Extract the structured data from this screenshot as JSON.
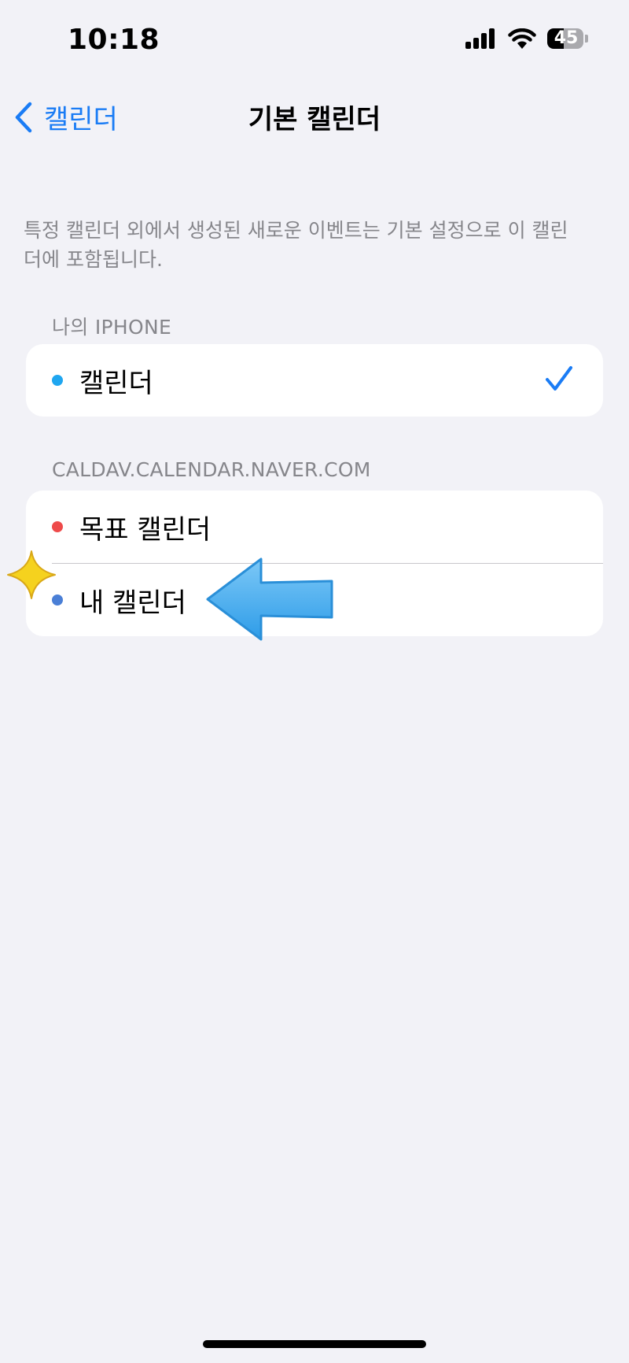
{
  "status_bar": {
    "time": "10:18",
    "battery_level": "45",
    "icons": [
      "signal-icon",
      "wifi-icon",
      "battery-icon"
    ]
  },
  "nav": {
    "back_label": "캘린더",
    "title": "기본 캘린더",
    "back_icon": "chevron-left-icon"
  },
  "description": "특정 캘린더 외에서 생성된 새로운 이벤트는 기본 설정으로 이 캘린더에 포함됩니다.",
  "sections": [
    {
      "header": "나의 IPHONE",
      "items": [
        {
          "label": "캘린더",
          "color": "#1fa6f0",
          "selected": true
        }
      ]
    },
    {
      "header": "CALDAV.CALENDAR.NAVER.COM",
      "items": [
        {
          "label": "목표 캘린더",
          "color": "#ee4a4a",
          "selected": false
        },
        {
          "label": "내 캘린더",
          "color": "#4a7fd6",
          "selected": false
        }
      ]
    }
  ],
  "colors": {
    "accent": "#1a7cf5",
    "background": "#f2f2f7",
    "secondary_text": "#86868b",
    "annotation_arrow": "#4fb4f2",
    "annotation_sparkle": "#f5d21e"
  },
  "annotations": {
    "arrow_icon": "arrow-left-icon",
    "sparkle_icon": "sparkle-icon"
  }
}
